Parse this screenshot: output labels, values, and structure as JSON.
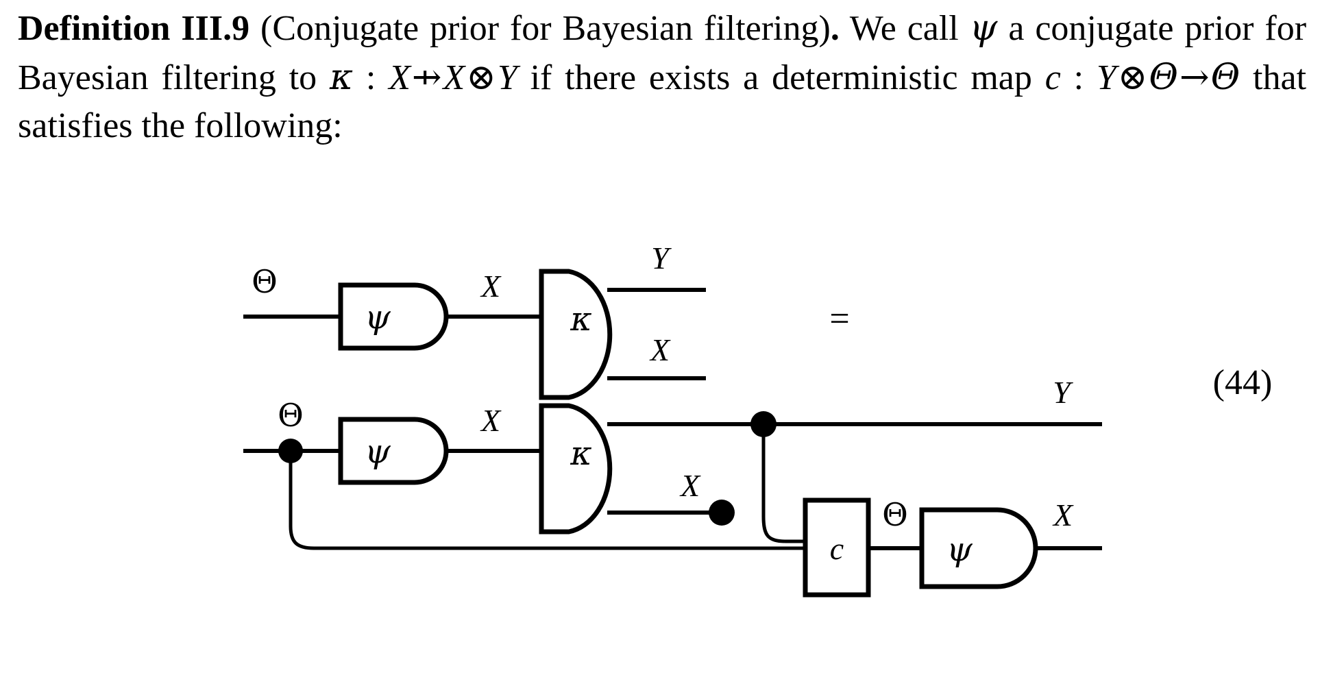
{
  "document": {
    "definition_label": "Definition III.9",
    "definition_title": "(Conjugate prior for Bayesian filtering)",
    "period": ".",
    "body_part_1": "We call ",
    "sym_psi": "ψ",
    "body_part_2": " a conjugate prior for Bayesian filtering to ",
    "sym_kappa": "κ",
    "body_part_3": " : ",
    "sym_X": "X",
    "arrow_probabilistic": "⇸",
    "sym_X2": "X",
    "sym_tensor": "⊗",
    "sym_Y": "Y",
    "body_part_4": " if there exists a deterministic map ",
    "sym_c": "c",
    "body_part_5": " : ",
    "sym_Y2": "Y",
    "sym_tensor2": "⊗",
    "sym_Theta": "Θ",
    "arrow_to": "→",
    "sym_Theta2": "Θ",
    "body_part_6": " that satisfies the following:",
    "equation_number": "(44)"
  },
  "diagram": {
    "equals_sign": "=",
    "top_row": {
      "input_label": "Θ",
      "box_psi": "ψ",
      "wire_label_x": "X",
      "box_kappa": "κ",
      "out_label_top": "Y",
      "out_label_bottom": "X"
    },
    "bottom_row": {
      "input_label": "Θ",
      "box_psi_left": "ψ",
      "wire_label_x": "X",
      "box_kappa": "κ",
      "out_label_y": "Y",
      "out_label_x_discard": "X",
      "box_c": "c",
      "theta_label": "Θ",
      "box_psi_right": "ψ",
      "out_label_x": "X"
    }
  },
  "icons": {
    "copy_dot": "copy-dot",
    "discard_dot": "discard-dot"
  },
  "colors": {
    "ink": "#000000",
    "paper": "#ffffff"
  }
}
